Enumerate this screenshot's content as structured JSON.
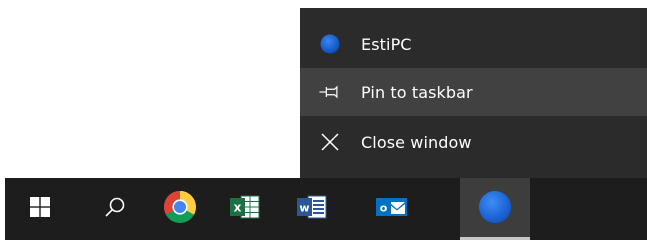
{
  "jumplist": {
    "app_title": "EstiPC",
    "pin_label": "Pin to taskbar",
    "close_label": "Close window",
    "app_icon": "blue-circle-icon",
    "pin_icon": "pin-icon",
    "close_icon": "close-icon"
  },
  "taskbar": {
    "items": [
      {
        "name": "start",
        "icon": "windows-logo-icon"
      },
      {
        "name": "search",
        "icon": "search-icon"
      },
      {
        "name": "chrome",
        "icon": "chrome-icon"
      },
      {
        "name": "excel",
        "icon": "excel-icon",
        "glyph": "x"
      },
      {
        "name": "word",
        "icon": "word-icon",
        "glyph": "w"
      },
      {
        "name": "outlook",
        "icon": "outlook-icon",
        "glyph": "o"
      },
      {
        "name": "estipc",
        "icon": "blue-circle-icon",
        "active": true
      }
    ]
  },
  "colors": {
    "menu_bg": "#2b2b2b",
    "menu_hover": "#414141",
    "taskbar_bg": "#1d1d1d",
    "active_bg": "#3d3d3d",
    "app_blue": "#1f6be0",
    "excel_green": "#1d7044",
    "word_blue": "#2b579a",
    "outlook_blue": "#0072c6"
  }
}
